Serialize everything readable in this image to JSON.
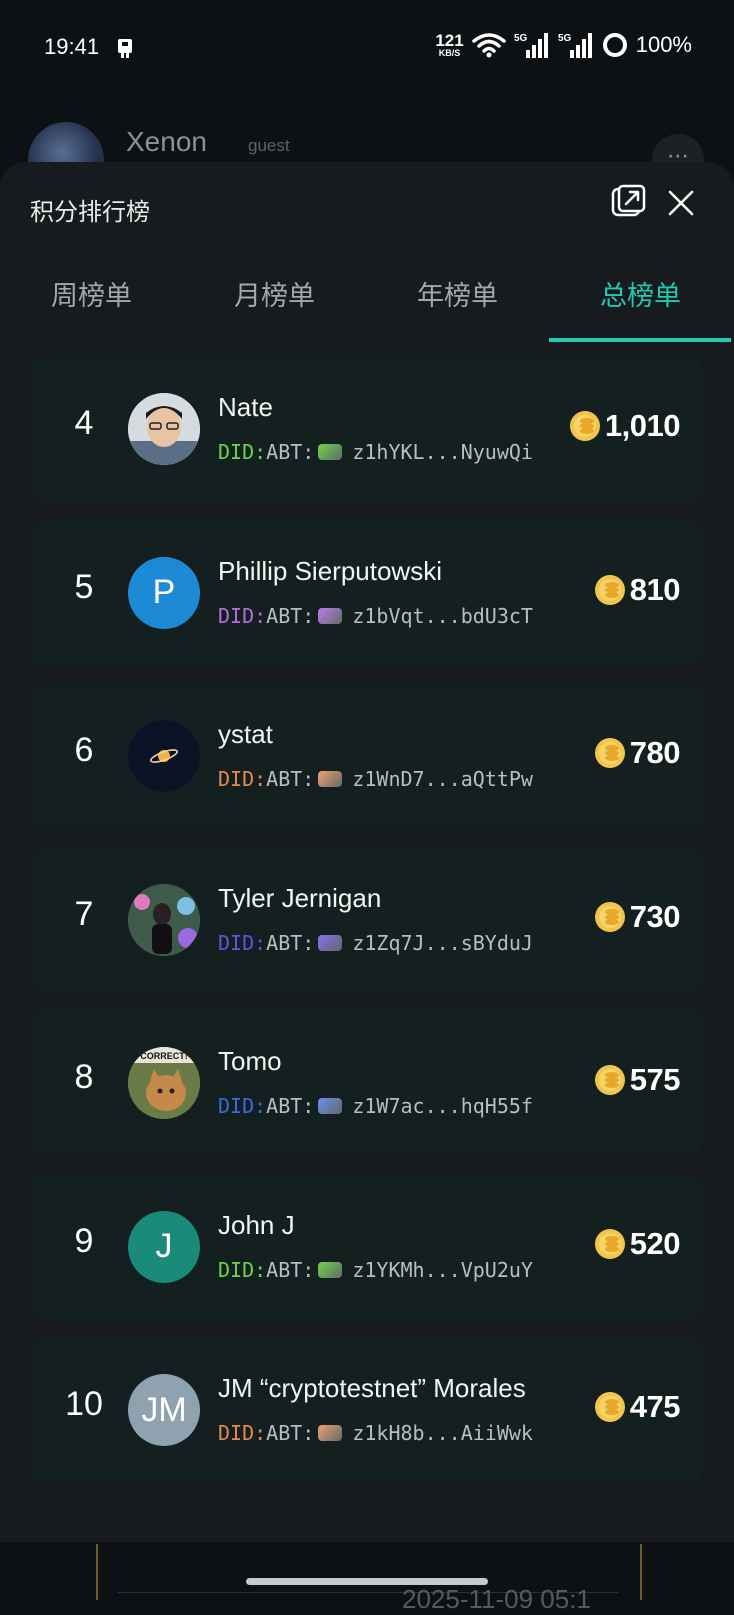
{
  "status_bar": {
    "time": "19:41",
    "net_speed_value": "121",
    "net_speed_unit": "KB/S",
    "signal1_label": "5G",
    "signal2_label": "5G",
    "battery": "100%"
  },
  "background": {
    "profile_name": "Xenon",
    "profile_role": "guest",
    "more_label": "⋯",
    "footer_date": "2025-11-09 05:1"
  },
  "sheet": {
    "title": "积分排行榜",
    "tabs": [
      {
        "label": "周榜单",
        "active": false
      },
      {
        "label": "月榜单",
        "active": false
      },
      {
        "label": "年榜单",
        "active": false
      },
      {
        "label": "总榜单",
        "active": true
      }
    ]
  },
  "leaderboard": [
    {
      "rank": "4",
      "name": "Nate",
      "did_prefix": "DID:",
      "did_mid": "ABT:",
      "did_value": "z1hYKL...NyuwQi",
      "did_color": "#6fd34a",
      "chip_color": "#6fd34a",
      "score": "1,010",
      "avatar_type": "photo",
      "avatar_initials": "",
      "avatar_color": "#cfd6dc"
    },
    {
      "rank": "5",
      "name": "Phillip Sierputowski",
      "did_prefix": "DID:",
      "did_mid": "ABT:",
      "did_value": "z1bVqt...bdU3cT",
      "did_color": "#b86be0",
      "chip_color": "#c07de8",
      "score": "810",
      "avatar_type": "initials",
      "avatar_initials": "P",
      "avatar_color": "#1d8ad6"
    },
    {
      "rank": "6",
      "name": "ystat",
      "did_prefix": "DID:",
      "did_mid": "ABT:",
      "did_value": "z1WnD7...aQttPw",
      "did_color": "#e58a4c",
      "chip_color": "#f0a070",
      "score": "780",
      "avatar_type": "planet",
      "avatar_initials": "",
      "avatar_color": "#0b1426"
    },
    {
      "rank": "7",
      "name": "Tyler Jernigan",
      "did_prefix": "DID:",
      "did_mid": "ABT:",
      "did_value": "z1Zq7J...sBYduJ",
      "did_color": "#6a4ee0",
      "chip_color": "#8b6cf0",
      "score": "730",
      "avatar_type": "photo2",
      "avatar_initials": "",
      "avatar_color": "#5a3f8a"
    },
    {
      "rank": "8",
      "name": "Tomo",
      "did_prefix": "DID:",
      "did_mid": "ABT:",
      "did_value": "z1W7ac...hqH55f",
      "did_color": "#3c6ae0",
      "chip_color": "#6a8ff0",
      "score": "575",
      "avatar_type": "photo3",
      "avatar_initials": "",
      "avatar_color": "#8a7a55"
    },
    {
      "rank": "9",
      "name": "John J",
      "did_prefix": "DID:",
      "did_mid": "ABT:",
      "did_value": "z1YKMh...VpU2uY",
      "did_color": "#6fd34a",
      "chip_color": "#6fd34a",
      "score": "520",
      "avatar_type": "initials",
      "avatar_initials": "J",
      "avatar_color": "#1a8a7a"
    },
    {
      "rank": "10",
      "name": "JM “cryptotestnet” Morales",
      "did_prefix": "DID:",
      "did_mid": "ABT:",
      "did_value": "z1kH8b...AiiWwk",
      "did_color": "#e58a4c",
      "chip_color": "#f0a070",
      "score": "475",
      "avatar_type": "initials",
      "avatar_initials": "JM",
      "avatar_color": "#8fa2b0"
    }
  ],
  "colors": {
    "accent": "#23c7b3",
    "sheet_bg": "#171b1d",
    "card_bg": "#13201f",
    "coin": "#f2c44a"
  }
}
